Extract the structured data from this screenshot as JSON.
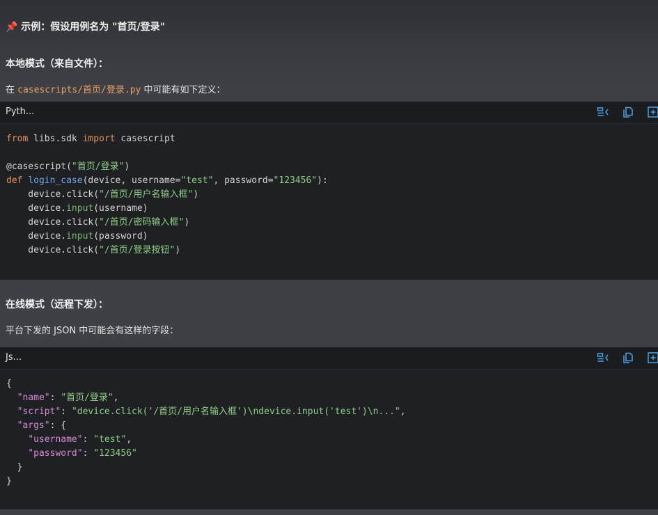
{
  "example_heading": "📌 示例：假设用例名为 \"首页/登录\"",
  "local_mode": {
    "heading": "本地模式（来自文件）：",
    "para_prefix": "在 ",
    "para_path": "casescripts/首页/登录.py",
    "para_suffix": " 中可能有如下定义："
  },
  "python_block": {
    "lang": "Pyth...",
    "lines": [
      [
        [
          "kw",
          "from"
        ],
        [
          "plain",
          " libs.sdk "
        ],
        [
          "kw",
          "import"
        ],
        [
          "plain",
          " casescript"
        ]
      ],
      [],
      [
        [
          "plain",
          "@casescript("
        ],
        [
          "str",
          "\"首页/登录\""
        ],
        [
          "plain",
          ")"
        ]
      ],
      [
        [
          "kw",
          "def"
        ],
        [
          "plain",
          " "
        ],
        [
          "fn",
          "login_case"
        ],
        [
          "plain",
          "(device, username="
        ],
        [
          "str",
          "\"test\""
        ],
        [
          "plain",
          ", password="
        ],
        [
          "str",
          "\"123456\""
        ],
        [
          "plain",
          "):"
        ]
      ],
      [
        [
          "plain",
          "    device.click("
        ],
        [
          "str",
          "\"/首页/用户名输入框\""
        ],
        [
          "plain",
          ")"
        ]
      ],
      [
        [
          "plain",
          "    device."
        ],
        [
          "meth",
          "input"
        ],
        [
          "plain",
          "(username)"
        ]
      ],
      [
        [
          "plain",
          "    device.click("
        ],
        [
          "str",
          "\"/首页/密码输入框\""
        ],
        [
          "plain",
          ")"
        ]
      ],
      [
        [
          "plain",
          "    device."
        ],
        [
          "meth",
          "input"
        ],
        [
          "plain",
          "(password)"
        ]
      ],
      [
        [
          "plain",
          "    device.click("
        ],
        [
          "str",
          "\"/首页/登录按钮\""
        ],
        [
          "plain",
          ")"
        ]
      ]
    ]
  },
  "online_mode": {
    "heading": "在线模式（远程下发）：",
    "para": "平台下发的 JSON 中可能会有这样的字段："
  },
  "json_block": {
    "lang": "Js...",
    "lines": [
      [
        [
          "plain",
          "{"
        ]
      ],
      [
        [
          "plain",
          "  "
        ],
        [
          "key",
          "\"name\""
        ],
        [
          "plain",
          ": "
        ],
        [
          "str",
          "\"首页/登录\""
        ],
        [
          "plain",
          ","
        ]
      ],
      [
        [
          "plain",
          "  "
        ],
        [
          "key",
          "\"script\""
        ],
        [
          "plain",
          ": "
        ],
        [
          "str",
          "\"device.click('/首页/用户名输入框')\\ndevice.input('test')\\n...\""
        ],
        [
          "plain",
          ","
        ]
      ],
      [
        [
          "plain",
          "  "
        ],
        [
          "key",
          "\"args\""
        ],
        [
          "plain",
          ": {"
        ]
      ],
      [
        [
          "plain",
          "    "
        ],
        [
          "key",
          "\"username\""
        ],
        [
          "plain",
          ": "
        ],
        [
          "str",
          "\"test\""
        ],
        [
          "plain",
          ","
        ]
      ],
      [
        [
          "plain",
          "    "
        ],
        [
          "key",
          "\"password\""
        ],
        [
          "plain",
          ": "
        ],
        [
          "str",
          "\"123456\""
        ]
      ],
      [
        [
          "plain",
          "  }"
        ]
      ],
      [
        [
          "plain",
          "}"
        ]
      ]
    ]
  },
  "toolbar_icons": [
    "wrap-toggle-icon",
    "copy-icon",
    "expand-icon"
  ]
}
